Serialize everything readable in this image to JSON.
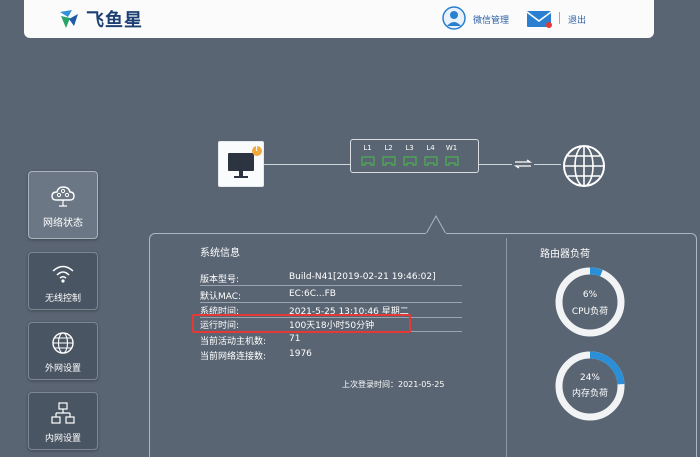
{
  "header": {
    "logo_text": "飞鱼星",
    "user_label": "微信管理",
    "logout_label": "退出"
  },
  "sidebar": {
    "items": [
      {
        "label": "网络状态",
        "icon": "cloud-network-icon",
        "active": true
      },
      {
        "label": "无线控制",
        "icon": "wifi-icon",
        "active": false
      },
      {
        "label": "外网设置",
        "icon": "globe-icon",
        "active": false
      },
      {
        "label": "内网设置",
        "icon": "lan-tree-icon",
        "active": false
      }
    ]
  },
  "topology": {
    "ports": [
      "L1",
      "L2",
      "L3",
      "L4",
      "W1"
    ],
    "pc_warning": "!"
  },
  "system_info": {
    "title": "系统信息",
    "rows": [
      {
        "key": "版本型号:",
        "value": "Build-N41[2019-02-21 19:46:02]"
      },
      {
        "key": "默认MAC:",
        "value": "EC:6C...FB"
      },
      {
        "key": "系统时间:",
        "value": "2021-5-25 13:10:46 星期二"
      },
      {
        "key": "运行时间:",
        "value": "100天18小时50分钟"
      },
      {
        "key": "当前活动主机数:",
        "value": "71"
      },
      {
        "key": "当前网络连接数:",
        "value": "1976"
      }
    ],
    "last_login": "上次登录时间：2021-05-25"
  },
  "router_load": {
    "title": "路由器负荷",
    "gauges": [
      {
        "percent_label": "6%",
        "label": "CPU负荷",
        "value": 6
      },
      {
        "percent_label": "24%",
        "label": "内存负荷",
        "value": 24
      }
    ]
  },
  "colors": {
    "background": "#5a6573",
    "accent": "#2a8fd6",
    "port_green": "#4caf50",
    "highlight": "#e53935"
  }
}
